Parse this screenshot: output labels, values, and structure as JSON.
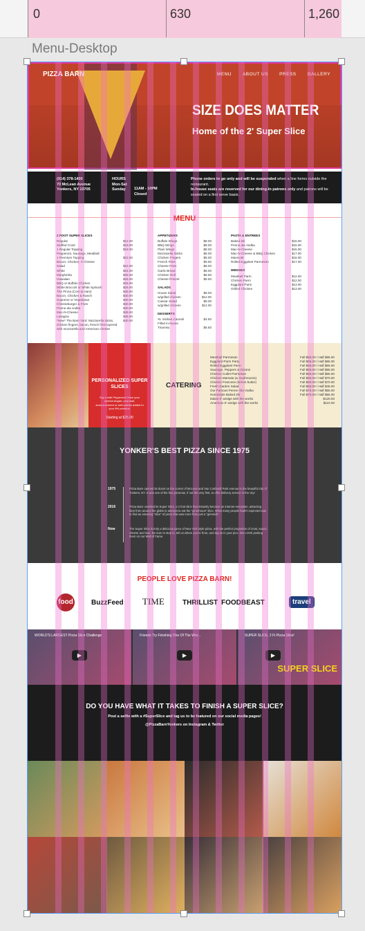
{
  "ruler": {
    "n0": "0",
    "n1": "630",
    "n2": "1,260"
  },
  "frame_label": "Menu-Desktop",
  "hero": {
    "brand": "PIZZA BARN",
    "nav": [
      "MENU",
      "ABOUT US",
      "PRESS",
      "GALLERY"
    ],
    "title": "SIZE DOES MATTER",
    "subtitle": "Home of the 2' Super Slice"
  },
  "info": {
    "phone": "(914) 378-1400",
    "address1": "70 McLean Avenue",
    "address2": "Yonkers, NY 10705",
    "hours_label": "HOURS",
    "days1": "Mon-Sat",
    "days2": "Sunday",
    "time1": "11AM - 10PM",
    "time2": "Closed",
    "notice1a": "Phone orders to go only and will be suspended",
    "notice1b": " when a line forms outside the restaurant.",
    "notice2a": "In-house seats are reserved for our dining-in patrons only",
    "notice2b": " and patrons will be seated on a first serve basis."
  },
  "menu": {
    "title": "MENU",
    "col1_head": "2 FOOT SUPER SLICES",
    "col1": [
      [
        "Regular",
        "$12.00"
      ],
      [
        "Stuffed Crust",
        "$18.00"
      ],
      [
        "1 Regular Topping",
        "$18.00"
      ],
      [
        "Pepperoni, Sausage, Meatball",
        ""
      ],
      [
        "1 Premium Topping",
        "$22.00"
      ],
      [
        "Bacon, Chicken, X Cheese",
        ""
      ],
      [
        "Salad",
        "$22.00"
      ],
      [
        "White",
        "$24.00"
      ],
      [
        "Margherita",
        "$25.00"
      ],
      [
        "Hawaiian",
        "$26.00"
      ],
      [
        "BBQ or Buffalo Chicken",
        "$26.00"
      ],
      [
        "White Broccoli or White Spinach",
        "$26.00"
      ],
      [
        "The Pinna (Corn & Ham)",
        "$28.00"
      ],
      [
        "Bacon, Chicken & Ranch",
        "$30.00"
      ],
      [
        "Supreme or Vegetarian",
        "$30.00"
      ],
      [
        "Cheeseburger & Fries",
        "$30.00"
      ],
      [
        "Penne ala vodka",
        "$30.00"
      ],
      [
        "Mac-N-Cheese",
        "$35.00"
      ],
      [
        "Lasagna",
        "$35.00"
      ],
      [
        "*New* The Barn Yard: Mozzarella sticks, chicken fingers, bacon, french fries layered with mozzarella and American cheese",
        "$40.00"
      ]
    ],
    "col2_head": "APPETIZERS",
    "col2": [
      [
        "Buffalo Wings",
        "$8.00"
      ],
      [
        "BBQ Wings",
        "$8.00"
      ],
      [
        "Plain Wings",
        "$8.00"
      ],
      [
        "Mozzarella Sticks",
        "$8.00"
      ],
      [
        "Chicken Fingers",
        "$8.00"
      ],
      [
        "French Fries",
        "$5.50"
      ],
      [
        "Cheese Fries",
        "$8.00"
      ],
      [
        "Garlic Bread",
        "$8.00"
      ],
      [
        "Chicken Roll",
        "$8.50"
      ],
      [
        "Cheese Pretzel",
        "$8.50"
      ]
    ],
    "salads_head": "SALADS",
    "salads": [
      [
        "House Salad",
        "$8.00"
      ],
      [
        "w/grilled chicken",
        "$12.00"
      ],
      [
        "Caesar Salad",
        "$8.00"
      ],
      [
        "w/grilled chicken",
        "$12.00"
      ]
    ],
    "desserts_head": "DESSERTS",
    "desserts": [
      [
        "XL Sicilian Cannoli",
        "$4.50"
      ],
      [
        "Filled in-house",
        ""
      ],
      [
        "Tiramisu",
        "$5.50"
      ]
    ],
    "col3_head": "PASTA & ENTREES",
    "col3": [
      [
        "Baked Ziti",
        "$15.00"
      ],
      [
        "Penne ala Vodka",
        "$15.00"
      ],
      [
        "Mac-N-Cheese",
        "$15.00"
      ],
      [
        "Mac-N-Cheese & BBQ Chicken",
        "$17.00"
      ],
      [
        "Manicotti",
        "$16.00"
      ],
      [
        "Rolled Eggplant Parmesan",
        "$17.00"
      ]
    ],
    "wedges_head": "WEDGES",
    "wedges": [
      [
        "Meatball Parm",
        "$12.00"
      ],
      [
        "Chicken Parm",
        "$12.00"
      ],
      [
        "Eggplant Parm",
        "$13.00"
      ],
      [
        "Grilled Chicken",
        "$13.00"
      ]
    ]
  },
  "personal": {
    "title": "PERSONALIZED SUPER SLICES",
    "desc": "Say it with Pepperoni! Have your special slogan, proposal, announcement or well-wishes added to your 8% portions.",
    "price": "Starting at $25.00"
  },
  "catering": {
    "title": "CATERING",
    "items": [
      [
        "Meatball Parmesan",
        "Full $85.00 / Half $65.00"
      ],
      [
        "Eggplant Parm Party",
        "Full $85.00 / Half $65.00"
      ],
      [
        "Rolled Eggplant Parm",
        "Full $85.00 / Half $65.00"
      ],
      [
        "Sausage, Peppers & Onions",
        "Full $85.00 / Half $65.00"
      ],
      [
        "Chicken Cutlet Parmesan",
        "Full $85.00 / Half $65.00"
      ],
      [
        "Chicken Marsala (w mushrooms)",
        "Full $90.00 / Half $70.00"
      ],
      [
        "Chicken Francese (lemon butter)",
        "Full $90.00 / Half $70.00"
      ],
      [
        "Fresh Garden Salad",
        "Full $55.00 / Half $45.00"
      ],
      [
        "Our Famous Penne Alla Vodka",
        "Full $75.00 / Half $55.00"
      ],
      [
        "Homestyle Baked Ziti",
        "Full $75.00 / Half $55.00"
      ],
      [
        "Italian 6' wedge with the works",
        "$120.00"
      ],
      [
        "American 6' wedge with the works",
        "$110.00"
      ]
    ]
  },
  "history": {
    "title": "YONKER'S BEST PIZZA SINCE 1975",
    "y1": "1975",
    "t1": "Pizza Barn opened its doors on the corner of McLean and Van Cortlandt Park Avenue in the beautiful city of Yonkers, NY. It was one of the few pizzerias, if not the very first, to offer delivery service in the city!",
    "y2": "2016",
    "t2": "Pizza Barn unveiled its Super Slice, a 2 foot slice that instantly became an internet sensation, attracting fans from around the globe to attempt to eat the \"ginormous\" slice. What many people hadn't expected was to find an amazing \"slice\" of pizza that was more than just a \"gimmick\".",
    "y3": "Now",
    "t3": "The Super Slice is truly a delicious piece of New York style pizza, with the perfect proportion of crust, sauce, cheese and love. Be sure to stop in, tell us where you're from, and tag us in your pics. We LOVE posting them on our Wall of Fame."
  },
  "press": {
    "title": "PEOPLE LOVE PIZZA BARN!",
    "logos": [
      "food",
      "BuzzFeed",
      "TIME",
      "THRILLIST",
      "FOODBEAST",
      "travel"
    ]
  },
  "videos": [
    {
      "caption": "WORLD'S LARGEST Pizza Slice Challenge"
    },
    {
      "caption": "Friends Try Finishing One Of The Wor..."
    },
    {
      "caption": "SUPER SLICE, 2 Ft Pizza Slice!"
    }
  ],
  "videos_overlay": "SUPER SLICE",
  "challenge": {
    "title": "DO YOU HAVE WHAT IT TAKES TO FINISH A SUPER SLICE?",
    "line1": "Post a selfie with a #SuperSlice and tag us to be featured on our social media pages!",
    "line2": "@PizzaBarnYonkers on Instagram & Twitter"
  }
}
